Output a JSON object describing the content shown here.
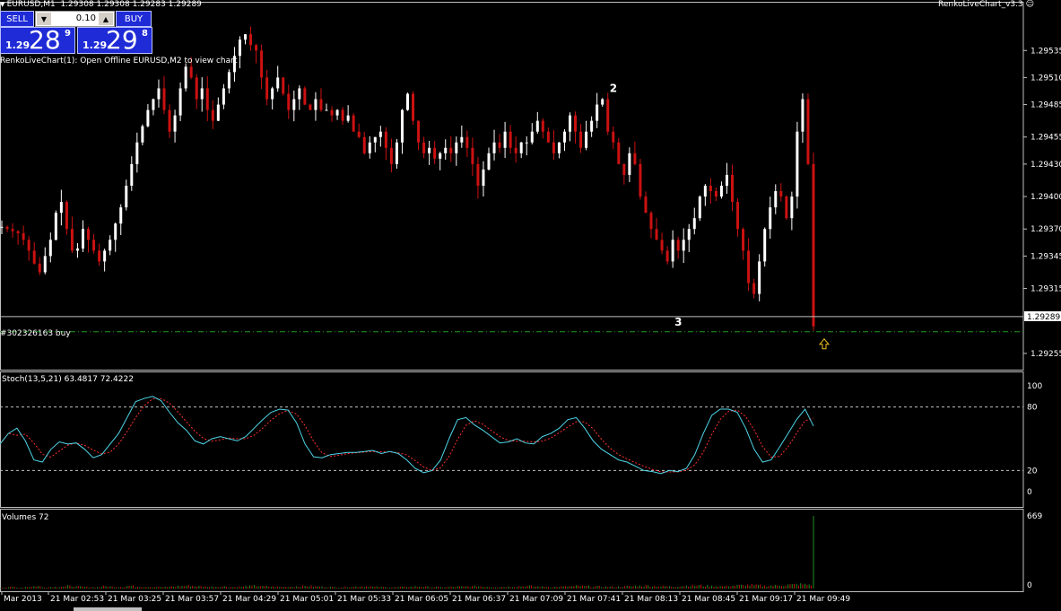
{
  "header": {
    "ohlc_text": "EURUSD,M1  1.29308 1.29308 1.29283 1.29289",
    "indicator_name": "RenkoLiveChart_v3.3",
    "info_line": "RenkoLiveChart(1): Open Offline EURUSD,M2 to view chart"
  },
  "trade_panel": {
    "sell_label": "SELL",
    "buy_label": "BUY",
    "lot_value": "0.10",
    "sell_price": {
      "prefix": "1.29",
      "big": "28",
      "sup": "9"
    },
    "buy_price": {
      "prefix": "1.29",
      "big": "29",
      "sup": "8"
    }
  },
  "order_line": {
    "label": "#302326163 buy",
    "price": 1.29275
  },
  "annotations": [
    {
      "text": "2",
      "time_index": 111,
      "price": 1.295
    },
    {
      "text": "3",
      "time_index": 123,
      "price": 1.29284
    }
  ],
  "current_price_label": "1.29289",
  "price_axis": {
    "labels": [
      "1.29510",
      "1.29485",
      "1.29455",
      "1.29430",
      "1.29400",
      "1.29370",
      "1.29345",
      "1.29315",
      "1.29255"
    ]
  },
  "stoch_panel": {
    "title": "Stoch(13,5,21) 63.4817 72.4222",
    "levels": [
      "100",
      "80",
      "20",
      "0"
    ]
  },
  "volume_panel": {
    "title": "Volumes 72",
    "max_label": "669",
    "min_label": "0"
  },
  "time_axis": [
    "Mar 2013",
    "21 Mar 02:53",
    "21 Mar 03:25",
    "21 Mar 03:57",
    "21 Mar 04:29",
    "21 Mar 05:01",
    "21 Mar 05:33",
    "21 Mar 06:05",
    "21 Mar 06:37",
    "21 Mar 07:09",
    "21 Mar 07:41",
    "21 Mar 08:13",
    "21 Mar 08:45",
    "21 Mar 09:17",
    "21 Mar 09:49"
  ],
  "colors": {
    "bull": "#ffffff",
    "bear": "#cc1111",
    "stoch_main": "#4fd6e8",
    "stoch_signal": "#ff3030",
    "volume": "#1f8f1f",
    "order_line": "#1f9b1f"
  },
  "chart_data": {
    "type": "candlestick",
    "price_range": [
      1.2924,
      1.2958
    ],
    "closes": [
      1.29372,
      1.2937,
      1.29368,
      1.29366,
      1.2936,
      1.2935,
      1.29338,
      1.2933,
      1.29345,
      1.2936,
      1.29385,
      1.29395,
      1.2937,
      1.2935,
      1.29352,
      1.2937,
      1.2936,
      1.2935,
      1.2934,
      1.2935,
      1.2936,
      1.29375,
      1.2939,
      1.2941,
      1.2943,
      1.2945,
      1.29465,
      1.2948,
      1.2949,
      1.295,
      1.2948,
      1.2946,
      1.29475,
      1.295,
      1.2952,
      1.2951,
      1.2949,
      1.295,
      1.2948,
      1.2947,
      1.29485,
      1.295,
      1.29515,
      1.2953,
      1.29545,
      1.2955,
      1.2954,
      1.29535,
      1.2951,
      1.2949,
      1.295,
      1.2951,
      1.29495,
      1.2948,
      1.2949,
      1.295,
      1.29485,
      1.2948,
      1.2949,
      1.2948,
      1.2948,
      1.29475,
      1.2948,
      1.2947,
      1.29475,
      1.2946,
      1.29455,
      1.2944,
      1.2945,
      1.29455,
      1.2946,
      1.29445,
      1.2943,
      1.2945,
      1.2948,
      1.29495,
      1.2947,
      1.2945,
      1.2944,
      1.29445,
      1.29435,
      1.2944,
      1.29445,
      1.2944,
      1.2945,
      1.29455,
      1.29445,
      1.2943,
      1.2941,
      1.29425,
      1.2944,
      1.2945,
      1.29445,
      1.2946,
      1.29445,
      1.2944,
      1.2945,
      1.2945,
      1.2946,
      1.2947,
      1.2946,
      1.2945,
      1.2944,
      1.2945,
      1.2946,
      1.29475,
      1.2946,
      1.29445,
      1.2946,
      1.2947,
      1.29485,
      1.2949,
      1.2946,
      1.2945,
      1.2943,
      1.2942,
      1.2944,
      1.2943,
      1.294,
      1.29385,
      1.2937,
      1.2936,
      1.2935,
      1.2934,
      1.2936,
      1.2935,
      1.2936,
      1.2937,
      1.2938,
      1.294,
      1.2941,
      1.29405,
      1.294,
      1.2941,
      1.2942,
      1.29395,
      1.2937,
      1.2935,
      1.2932,
      1.2931,
      1.2934,
      1.2937,
      1.2939,
      1.29405,
      1.294,
      1.2938,
      1.294,
      1.2946,
      1.2949,
      1.2943,
      1.2928
    ],
    "stoch_main": [
      45,
      55,
      60,
      48,
      30,
      28,
      40,
      47,
      45,
      46,
      40,
      32,
      35,
      45,
      55,
      70,
      85,
      88,
      90,
      86,
      75,
      65,
      58,
      48,
      45,
      50,
      52,
      50,
      48,
      52,
      60,
      68,
      75,
      78,
      77,
      65,
      45,
      33,
      32,
      35,
      36,
      37,
      37,
      38,
      39,
      36,
      38,
      36,
      30,
      22,
      18,
      20,
      30,
      50,
      68,
      70,
      63,
      58,
      52,
      46,
      47,
      50,
      46,
      45,
      52,
      55,
      60,
      68,
      70,
      60,
      48,
      40,
      35,
      30,
      28,
      24,
      20,
      19,
      17,
      20,
      19,
      22,
      35,
      55,
      72,
      78,
      78,
      75,
      60,
      40,
      28,
      30,
      42,
      55,
      68,
      78,
      62
    ],
    "volumes": [
      12,
      15,
      10,
      18,
      22,
      14,
      16,
      20,
      24,
      18,
      15,
      13,
      22,
      19,
      17,
      25,
      20,
      18,
      16,
      14,
      20,
      24,
      28,
      22,
      19,
      18,
      21,
      15,
      17,
      23,
      26,
      20,
      18,
      16,
      19,
      22,
      24,
      20,
      17,
      15,
      14,
      18,
      20,
      22,
      16,
      14,
      12,
      15,
      18,
      20,
      17,
      15,
      13,
      16,
      18,
      20,
      22,
      18,
      15,
      17,
      19,
      22,
      24,
      20,
      18,
      16,
      19,
      21,
      25,
      22,
      20,
      18,
      17,
      19,
      22,
      26,
      28,
      24,
      22,
      20,
      25,
      28,
      30,
      26,
      24,
      22,
      28,
      30,
      34,
      30,
      26,
      28,
      32,
      36,
      40,
      38,
      669
    ]
  }
}
